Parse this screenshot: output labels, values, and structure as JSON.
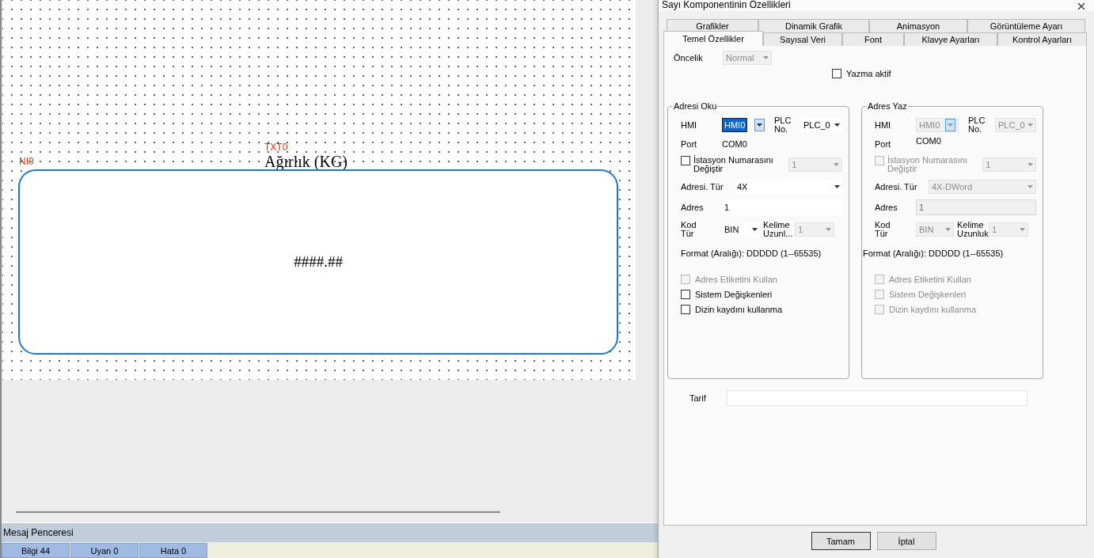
{
  "canvas": {
    "number_label": "NI0",
    "text_label": "TXT0",
    "caption": "Ağırlık (KG)",
    "display_value": "####.##"
  },
  "message_window": {
    "title": "Mesaj Penceresi",
    "tabs": [
      {
        "label": "Bilgi 44"
      },
      {
        "label": "Uyan 0"
      },
      {
        "label": "Hata 0"
      }
    ]
  },
  "dialog": {
    "title": "Sayı Komponentinin Özellikleri",
    "tab_rows": [
      [
        {
          "label": "Grafikler",
          "selected": false
        },
        {
          "label": "Dinamik Grafik",
          "selected": false
        },
        {
          "label": "Animasyon",
          "selected": false
        },
        {
          "label": "Görüntüleme Ayarı",
          "selected": false
        }
      ],
      [
        {
          "label": "Temel Özellikler",
          "selected": true
        },
        {
          "label": "Sayısal Veri",
          "selected": false
        },
        {
          "label": "Font",
          "selected": false
        },
        {
          "label": "Klavye Ayarları",
          "selected": false
        },
        {
          "label": "Kontrol Ayarları",
          "selected": false
        }
      ]
    ],
    "priority": {
      "label": "Öncelik",
      "value": "Normal",
      "disabled": true
    },
    "write_enable": {
      "label": "Yazma aktif",
      "checked": false
    },
    "groups": [
      {
        "title": "Adresi Oku",
        "disabled": false,
        "hmi": {
          "label": "HMI",
          "value": "HMI0",
          "focused": true
        },
        "plc": {
          "label": "PLC No.",
          "value": "PLC_0"
        },
        "port": {
          "label": "Port",
          "value": "COM0"
        },
        "station": {
          "label": "İstasyon Numarasını Değiştir",
          "checked": false,
          "value": "1",
          "disabled": true
        },
        "address_type": {
          "label": "Adresi. Tür",
          "value": "4X"
        },
        "address": {
          "label": "Adres",
          "value": "1"
        },
        "code_type": {
          "label": "Kod Tür",
          "value": "BIN"
        },
        "word_length": {
          "label": "Kelime Uzunl...",
          "value": "1",
          "disabled": true
        },
        "format": "Format (Aralığı): DDDDD (1--65535)",
        "checkboxes": [
          {
            "label": "Adres Etiketini Kullan",
            "checked": false,
            "disabled": true
          },
          {
            "label": "Sistem Değişkenleri",
            "checked": false,
            "disabled": false
          },
          {
            "label": "Dizin kaydını kullanma",
            "checked": false,
            "disabled": false
          }
        ]
      },
      {
        "title": "Adres Yaz",
        "disabled": true,
        "hmi": {
          "label": "HMI",
          "value": "HMI0",
          "focused": false
        },
        "plc": {
          "label": "PLC No.",
          "value": "PLC_0"
        },
        "port": {
          "label": "Port",
          "value": "COM0"
        },
        "station": {
          "label": "İstasyon Numarasını Değiştir",
          "checked": false,
          "value": "1",
          "disabled": true
        },
        "address_type": {
          "label": "Adresi. Tür",
          "value": "4X-DWord"
        },
        "address": {
          "label": "Adres",
          "value": "1"
        },
        "code_type": {
          "label": "Kod Tür",
          "value": "BIN"
        },
        "word_length": {
          "label": "Kelime Uzunluk",
          "value": "1",
          "disabled": true
        },
        "format": "Format (Aralığı): DDDDD (1--65535)",
        "checkboxes": [
          {
            "label": "Adres Etiketini Kullan",
            "checked": false,
            "disabled": true
          },
          {
            "label": "Sistem Değişkenleri",
            "checked": false,
            "disabled": true
          },
          {
            "label": "Dizin kaydını kullanma",
            "checked": false,
            "disabled": true
          }
        ]
      }
    ],
    "description": {
      "label": "Tarif"
    },
    "buttons": [
      "Tamam",
      "İptal"
    ]
  }
}
